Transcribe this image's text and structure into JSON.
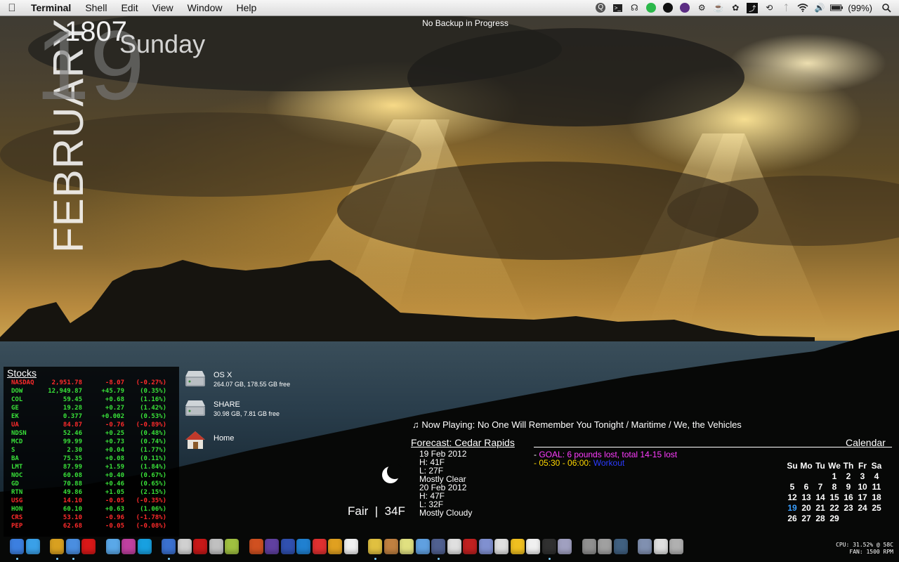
{
  "menubar": {
    "apple_icon": "apple-icon",
    "app_name": "Terminal",
    "menus": [
      "Shell",
      "Edit",
      "View",
      "Window",
      "Help"
    ],
    "status_icons": [
      "quicksilver-icon",
      "terminal-icon",
      "headphones-icon",
      "green-status-icon",
      "black-status-icon",
      "purple-status-icon",
      "gear-icon",
      "cup-icon",
      "paw-icon",
      "lightning-icon",
      "time-machine-icon",
      "bluetooth-icon",
      "wifi-icon",
      "volume-icon"
    ],
    "battery": "(99%)",
    "spotlight_icon": "magnifier-icon"
  },
  "date_widget": {
    "month": "FEBRUARY",
    "day": "19",
    "time": "1807",
    "weekday": "Sunday"
  },
  "backup_status": "No Backup in Progress",
  "stocks": {
    "title": "Stocks",
    "rows": [
      {
        "sym": "NASDAQ",
        "price": "2,951.78",
        "chg": "-8.07",
        "pct": "(-0.27%)",
        "dir": "down"
      },
      {
        "sym": "DOW",
        "price": "12,949.87",
        "chg": "+45.79",
        "pct": "(0.35%)",
        "dir": "up"
      },
      {
        "sym": "COL",
        "price": "59.45",
        "chg": "+0.68",
        "pct": "(1.16%)",
        "dir": "up"
      },
      {
        "sym": "GE",
        "price": "19.28",
        "chg": "+0.27",
        "pct": "(1.42%)",
        "dir": "up"
      },
      {
        "sym": "EK",
        "price": "0.377",
        "chg": "+0.002",
        "pct": "(0.53%)",
        "dir": "up"
      },
      {
        "sym": "UA",
        "price": "84.87",
        "chg": "-0.76",
        "pct": "(-0.89%)",
        "dir": "down"
      },
      {
        "sym": "NDSN",
        "price": "52.46",
        "chg": "+0.25",
        "pct": "(0.48%)",
        "dir": "up"
      },
      {
        "sym": "MCD",
        "price": "99.99",
        "chg": "+0.73",
        "pct": "(0.74%)",
        "dir": "up"
      },
      {
        "sym": "S",
        "price": "2.30",
        "chg": "+0.04",
        "pct": "(1.77%)",
        "dir": "up"
      },
      {
        "sym": "BA",
        "price": "75.35",
        "chg": "+0.08",
        "pct": "(0.11%)",
        "dir": "up"
      },
      {
        "sym": "LMT",
        "price": "87.99",
        "chg": "+1.59",
        "pct": "(1.84%)",
        "dir": "up"
      },
      {
        "sym": "NOC",
        "price": "60.08",
        "chg": "+0.40",
        "pct": "(0.67%)",
        "dir": "up"
      },
      {
        "sym": "GD",
        "price": "70.88",
        "chg": "+0.46",
        "pct": "(0.65%)",
        "dir": "up"
      },
      {
        "sym": "RTN",
        "price": "49.86",
        "chg": "+1.05",
        "pct": "(2.15%)",
        "dir": "up"
      },
      {
        "sym": "USG",
        "price": "14.10",
        "chg": "-0.05",
        "pct": "(-0.35%)",
        "dir": "down"
      },
      {
        "sym": "HON",
        "price": "60.10",
        "chg": "+0.63",
        "pct": "(1.06%)",
        "dir": "up"
      },
      {
        "sym": "CRS",
        "price": "53.10",
        "chg": "-0.96",
        "pct": "(-1.78%)",
        "dir": "down"
      },
      {
        "sym": "PEP",
        "price": "62.68",
        "chg": "-0.05",
        "pct": "(-0.08%)",
        "dir": "down"
      }
    ]
  },
  "drives": [
    {
      "name": "OS X",
      "info": "264.07 GB, 178.55 GB free",
      "icon": "hard-drive-icon"
    },
    {
      "name": "SHARE",
      "info": "30.98 GB, 7.81 GB free",
      "icon": "hard-drive-icon"
    },
    {
      "name": "Home",
      "info": "",
      "icon": "home-folder-icon"
    }
  ],
  "now_playing": "♫ Now Playing: No One Will Remember You Tonight / Maritime / We, the Vehicles",
  "forecast": {
    "title": "Forecast: Cedar Rapids",
    "days": [
      {
        "date": "19 Feb 2012",
        "high": "H: 41F",
        "low": "L: 27F",
        "cond": "Mostly Clear"
      },
      {
        "date": "20 Feb 2012",
        "high": "H: 47F",
        "low": "L: 32F",
        "cond": "Mostly Cloudy"
      }
    ],
    "current": "Fair  |  34F",
    "icon": "moon-icon"
  },
  "calendar": {
    "title": "Calendar",
    "goal_prefix": "- ",
    "goal": "GOAL: 6 pounds lost, total 14-15 lost",
    "event_time": "- 05:30 - 06:00: ",
    "event_name": "Workout",
    "weekdays": [
      "Su",
      "Mo",
      "Tu",
      "We",
      "Th",
      "Fr",
      "Sa"
    ],
    "weeks": [
      [
        "",
        "",
        "",
        "1",
        "2",
        "3",
        "4"
      ],
      [
        "5",
        "6",
        "7",
        "8",
        "9",
        "10",
        "11"
      ],
      [
        "12",
        "13",
        "14",
        "15",
        "16",
        "17",
        "18"
      ],
      [
        "19",
        "20",
        "21",
        "22",
        "23",
        "24",
        "25"
      ],
      [
        "26",
        "27",
        "28",
        "29",
        "",
        "",
        ""
      ]
    ],
    "today": "19"
  },
  "dock": {
    "items": [
      {
        "name": "finder",
        "color": "#3c7fe0"
      },
      {
        "name": "app-store",
        "color": "#3aa0e8"
      },
      {
        "name": "chrome",
        "color": "#d8a020"
      },
      {
        "name": "safari",
        "color": "#4a8ee0"
      },
      {
        "name": "opera",
        "color": "#d81818"
      },
      {
        "name": "messages",
        "color": "#5aa8e8"
      },
      {
        "name": "growl",
        "color": "#c040a0"
      },
      {
        "name": "skype",
        "color": "#18a0e0"
      },
      {
        "name": "itunes",
        "color": "#3a70d0"
      },
      {
        "name": "instruments",
        "color": "#d0d0d0"
      },
      {
        "name": "photo-booth",
        "color": "#c81818"
      },
      {
        "name": "ipod-util",
        "color": "#c0c0c0"
      },
      {
        "name": "plant",
        "color": "#a0c040"
      },
      {
        "name": "preview",
        "color": "#d05020"
      },
      {
        "name": "pencil",
        "color": "#6040a0"
      },
      {
        "name": "textwrangler",
        "color": "#3050b0"
      },
      {
        "name": "mail",
        "color": "#2080d0"
      },
      {
        "name": "gem",
        "color": "#e03030"
      },
      {
        "name": "dashboard",
        "color": "#e0a020"
      },
      {
        "name": "ical",
        "color": "#f0f0f0"
      },
      {
        "name": "photoshop",
        "color": "#e0c040"
      },
      {
        "name": "gallery",
        "color": "#c08040"
      },
      {
        "name": "pencils",
        "color": "#e0e080"
      },
      {
        "name": "network",
        "color": "#60a0e0"
      },
      {
        "name": "cyberduck",
        "color": "#506090"
      },
      {
        "name": "upload",
        "color": "#e0e0e0"
      },
      {
        "name": "red-book",
        "color": "#c02020"
      },
      {
        "name": "moon",
        "color": "#8090d0"
      },
      {
        "name": "star",
        "color": "#e0e0e0"
      },
      {
        "name": "adium",
        "color": "#f0c020"
      },
      {
        "name": "x11",
        "color": "#f0f0f0"
      },
      {
        "name": "terminal",
        "color": "#303030"
      },
      {
        "name": "utilities",
        "color": "#a0a0c0"
      },
      {
        "name": "activity-monitor",
        "color": "#909090"
      },
      {
        "name": "disk-utility",
        "color": "#a0a0a0"
      },
      {
        "name": "time-machine",
        "color": "#406080"
      },
      {
        "name": "applications",
        "color": "#8090b0"
      },
      {
        "name": "documents",
        "color": "#e0e0e0"
      },
      {
        "name": "trash",
        "color": "#b0b0b0"
      }
    ]
  },
  "system": {
    "cpu": "CPU: 31.52% @ 58C",
    "fan": "FAN: 1500 RPM"
  }
}
